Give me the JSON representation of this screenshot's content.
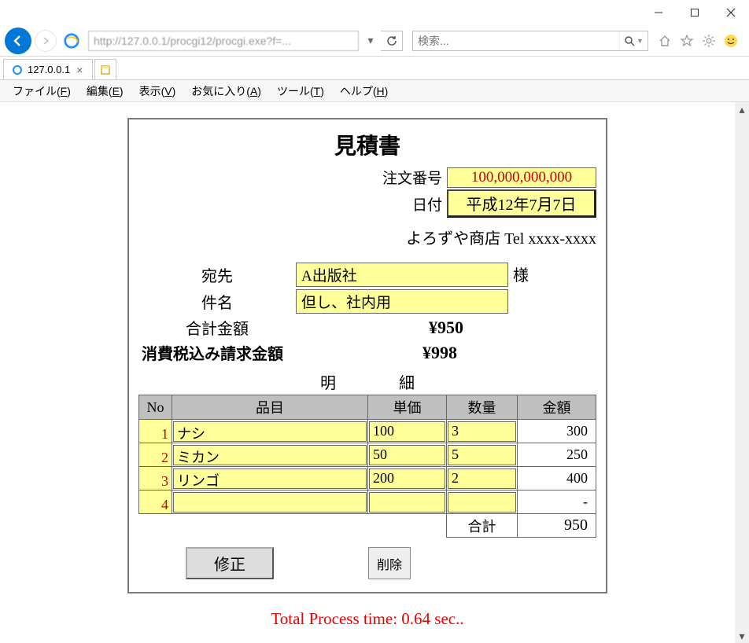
{
  "window": {
    "search_placeholder": "検索..."
  },
  "tab": {
    "title": "127.0.0.1"
  },
  "menu": {
    "file": "ファイル(F)",
    "edit": "編集(E)",
    "view": "表示(V)",
    "fav": "お気に入り(A)",
    "tool": "ツール(T)",
    "help": "ヘルプ(H)"
  },
  "doc": {
    "title": "見積書",
    "order_label": "注文番号",
    "order_no": "100,000,000,000",
    "date_label": "日付",
    "date": "平成12年7月7日",
    "shop": "よろずや商店 Tel xxxx-xxxx",
    "to_label": "宛先",
    "to": "A出版社",
    "to_suffix": "様",
    "subject_label": "件名",
    "subject": "但し、社内用",
    "sum_label": "合計金額",
    "sum": "¥950",
    "taxsum_label": "消費税込み請求金額",
    "taxsum": "¥998",
    "detail_heading": "明細",
    "th": {
      "no": "No",
      "item": "品目",
      "price": "単価",
      "qty": "数量",
      "amount": "金額"
    },
    "rows": [
      {
        "no": "1",
        "item": "ナシ",
        "price": "100",
        "qty": "3",
        "amount": "300"
      },
      {
        "no": "2",
        "item": "ミカン",
        "price": "50",
        "qty": "5",
        "amount": "250"
      },
      {
        "no": "3",
        "item": "リンゴ",
        "price": "200",
        "qty": "2",
        "amount": "400"
      },
      {
        "no": "4",
        "item": "",
        "price": "",
        "qty": "",
        "amount": "-"
      }
    ],
    "total_label": "合計",
    "total": "950",
    "btn_modify": "修正",
    "btn_delete": "削除"
  },
  "footer": {
    "ptime": "Total Process time: 0.64 sec.."
  }
}
